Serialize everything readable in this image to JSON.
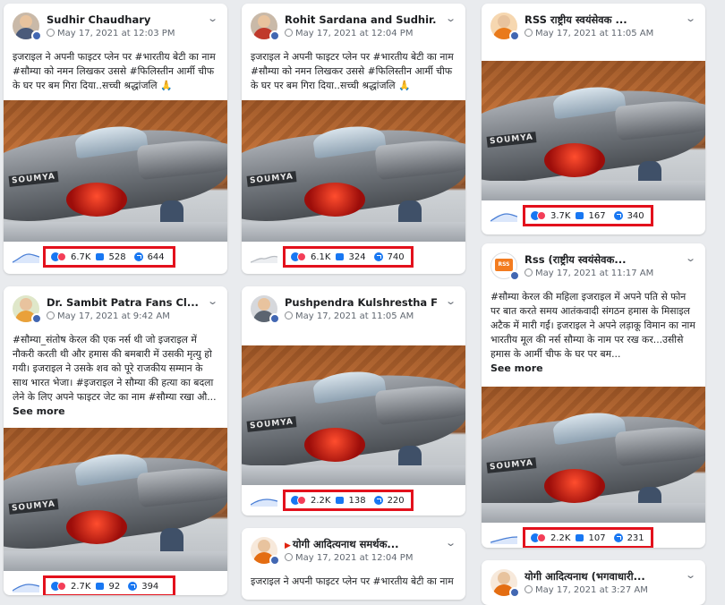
{
  "cards": [
    {
      "name": "Sudhir Chaudhary",
      "date": "May 17, 2021 at 12:03 PM",
      "text": "इजराइल ने अपनी फाइटर प्लेन पर #भारतीय बेटी का नाम #सौम्या को नमन लिखकर उससे #फिलिस्तीन आर्मी चीफ के घर पर बम गिरा दिया..सच्ची श्रद्धांजलि 🙏",
      "see_more": "",
      "decal": "SOUMYA",
      "reactions": "6.7K",
      "comments": "528",
      "shares": "644"
    },
    {
      "name": "Rohit Sardana and Sudhir...",
      "date": "May 17, 2021 at 12:04 PM",
      "text": "इजराइल ने अपनी फाइटर प्लेन पर #भारतीय बेटी का नाम #सौम्या को नमन लिखकर उससे #फिलिस्तीन आर्मी चीफ के घर पर बम गिरा दिया..सच्ची श्रद्धांजलि 🙏",
      "see_more": "",
      "decal": "SOUMYA",
      "reactions": "6.1K",
      "comments": "324",
      "shares": "740"
    },
    {
      "name": "RSS राष्ट्रीय स्वयंसेवक ...",
      "date": "May 17, 2021 at 11:05 AM",
      "text": "",
      "see_more": "",
      "decal": "SOUMYA",
      "reactions": "3.7K",
      "comments": "167",
      "shares": "340"
    },
    {
      "name": "Dr. Sambit Patra Fans Cl...",
      "date": "May 17, 2021 at 9:42 AM",
      "text": "#सौम्या_संतोष केरल की एक नर्स थी जो इजराइल में नौकरी करती थी और हमास की बमबारी में उसकी मृत्यु हो गयी। इजराइल ने उसके शव को पूरे राजकीय सम्मान के साथ भारत भेजा। #इजराइल ने सौम्या की हत्या का बदला लेने के लिए अपने फाइटर जेट का नाम #सौम्या रखा औ...",
      "see_more": "See more",
      "decal": "SOUMYA",
      "reactions": "2.7K",
      "comments": "92",
      "shares": "394"
    },
    {
      "name": "Pushpendra Kulshrestha F...",
      "date": "May 17, 2021 at 11:05 AM",
      "text": "",
      "see_more": "",
      "decal": "SOUMYA",
      "reactions": "2.2K",
      "comments": "138",
      "shares": "220"
    },
    {
      "name": "Rss (राष्ट्रीय स्वयंसेवक...",
      "date": "May 17, 2021 at 11:17 AM",
      "text": "#सौम्या केरल की महिला इजराइल में अपने पति से फोन पर बात करते समय आतंकवादी संगठन हमास के मिसाइल अटैक में मारी गईं। इजराइल ने अपने लड़ाकू विमान का नाम भारतीय मूल की नर्स सौम्या के नाम पर रख कर...उसीसे हमास के आर्मी चीफ के घर पर बम...",
      "see_more": "See more",
      "decal": "SOUMYA",
      "reactions": "2.2K",
      "comments": "107",
      "shares": "231"
    },
    {
      "name": "योगी आदित्यनाथ समर्थक...",
      "date": "May 17, 2021 at 12:04 PM",
      "text": "इजराइल ने अपनी फाइटर प्लेन पर #भारतीय बेटी का नाम",
      "see_more": "",
      "decal": "",
      "reactions": "",
      "comments": "",
      "shares": ""
    },
    {
      "name": "योगी आदित्यनाथ (भगवाधारी...",
      "date": "May 17, 2021 at 3:27 AM",
      "text": "",
      "see_more": "",
      "decal": "",
      "reactions": "",
      "comments": "",
      "shares": ""
    }
  ],
  "icons": {
    "post_menu": "chevron-down-icon",
    "audience": "globe-icon",
    "reactions": "like-love-reaction-icons",
    "comments": "comment-icon",
    "shares": "share-icon",
    "sparkline": "interaction-sparkline-icon"
  },
  "colors": {
    "highlight_box": "#e3111c",
    "facebook_blue": "#1877f2"
  }
}
